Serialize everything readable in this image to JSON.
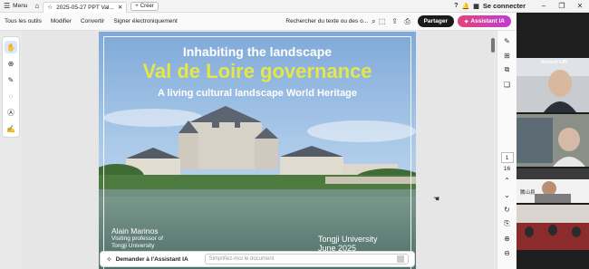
{
  "titlebar": {
    "menu_label": "Menu",
    "tab_title": "2025-05-27 PPT Val...",
    "new_label": "Créer",
    "account_label": "Se connecter"
  },
  "menubar": {
    "items": [
      "Tous les outils",
      "Modifier",
      "Convertir",
      "Signer électroniquement"
    ],
    "search_label": "Rechercher du texte ou des o...",
    "share_label": "Partager",
    "ai_label": "Assistant IA"
  },
  "slide": {
    "title_line1": "Inhabiting the landscape",
    "title_line2": "Val de Loire governance",
    "title_line3": "A living cultural landscape World Heritage",
    "author_name": "Alain Marinos",
    "author_role": "Visiting professor of",
    "author_uni": "Tongji University",
    "university": "Tongji University",
    "date": "June 2025"
  },
  "assistant": {
    "label": "Demander à l'Assistant IA",
    "placeholder": "Simplifiez-moi le document"
  },
  "pagination": {
    "current": "1",
    "total": "16"
  },
  "video": {
    "participants": [
      {
        "name": "Roland LIN"
      },
      {
        "name": ""
      },
      {
        "name": "騰山县"
      },
      {
        "name": ""
      }
    ]
  },
  "colors": {
    "accent": "#1b5fd1",
    "ai_gradient_start": "#e0457b",
    "ai_gradient_end": "#c23bd4",
    "title_yellow": "#e6e64a"
  }
}
